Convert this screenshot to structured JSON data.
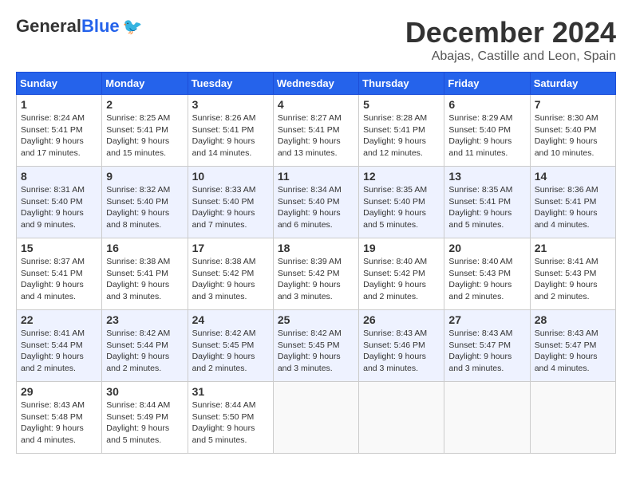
{
  "header": {
    "logo_general": "General",
    "logo_blue": "Blue",
    "month_title": "December 2024",
    "location": "Abajas, Castille and Leon, Spain"
  },
  "weekdays": [
    "Sunday",
    "Monday",
    "Tuesday",
    "Wednesday",
    "Thursday",
    "Friday",
    "Saturday"
  ],
  "weeks": [
    [
      {
        "day": "1",
        "sunrise": "8:24 AM",
        "sunset": "5:41 PM",
        "daylight": "9 hours and 17 minutes."
      },
      {
        "day": "2",
        "sunrise": "8:25 AM",
        "sunset": "5:41 PM",
        "daylight": "9 hours and 15 minutes."
      },
      {
        "day": "3",
        "sunrise": "8:26 AM",
        "sunset": "5:41 PM",
        "daylight": "9 hours and 14 minutes."
      },
      {
        "day": "4",
        "sunrise": "8:27 AM",
        "sunset": "5:41 PM",
        "daylight": "9 hours and 13 minutes."
      },
      {
        "day": "5",
        "sunrise": "8:28 AM",
        "sunset": "5:41 PM",
        "daylight": "9 hours and 12 minutes."
      },
      {
        "day": "6",
        "sunrise": "8:29 AM",
        "sunset": "5:40 PM",
        "daylight": "9 hours and 11 minutes."
      },
      {
        "day": "7",
        "sunrise": "8:30 AM",
        "sunset": "5:40 PM",
        "daylight": "9 hours and 10 minutes."
      }
    ],
    [
      {
        "day": "8",
        "sunrise": "8:31 AM",
        "sunset": "5:40 PM",
        "daylight": "9 hours and 9 minutes."
      },
      {
        "day": "9",
        "sunrise": "8:32 AM",
        "sunset": "5:40 PM",
        "daylight": "9 hours and 8 minutes."
      },
      {
        "day": "10",
        "sunrise": "8:33 AM",
        "sunset": "5:40 PM",
        "daylight": "9 hours and 7 minutes."
      },
      {
        "day": "11",
        "sunrise": "8:34 AM",
        "sunset": "5:40 PM",
        "daylight": "9 hours and 6 minutes."
      },
      {
        "day": "12",
        "sunrise": "8:35 AM",
        "sunset": "5:40 PM",
        "daylight": "9 hours and 5 minutes."
      },
      {
        "day": "13",
        "sunrise": "8:35 AM",
        "sunset": "5:41 PM",
        "daylight": "9 hours and 5 minutes."
      },
      {
        "day": "14",
        "sunrise": "8:36 AM",
        "sunset": "5:41 PM",
        "daylight": "9 hours and 4 minutes."
      }
    ],
    [
      {
        "day": "15",
        "sunrise": "8:37 AM",
        "sunset": "5:41 PM",
        "daylight": "9 hours and 4 minutes."
      },
      {
        "day": "16",
        "sunrise": "8:38 AM",
        "sunset": "5:41 PM",
        "daylight": "9 hours and 3 minutes."
      },
      {
        "day": "17",
        "sunrise": "8:38 AM",
        "sunset": "5:42 PM",
        "daylight": "9 hours and 3 minutes."
      },
      {
        "day": "18",
        "sunrise": "8:39 AM",
        "sunset": "5:42 PM",
        "daylight": "9 hours and 3 minutes."
      },
      {
        "day": "19",
        "sunrise": "8:40 AM",
        "sunset": "5:42 PM",
        "daylight": "9 hours and 2 minutes."
      },
      {
        "day": "20",
        "sunrise": "8:40 AM",
        "sunset": "5:43 PM",
        "daylight": "9 hours and 2 minutes."
      },
      {
        "day": "21",
        "sunrise": "8:41 AM",
        "sunset": "5:43 PM",
        "daylight": "9 hours and 2 minutes."
      }
    ],
    [
      {
        "day": "22",
        "sunrise": "8:41 AM",
        "sunset": "5:44 PM",
        "daylight": "9 hours and 2 minutes."
      },
      {
        "day": "23",
        "sunrise": "8:42 AM",
        "sunset": "5:44 PM",
        "daylight": "9 hours and 2 minutes."
      },
      {
        "day": "24",
        "sunrise": "8:42 AM",
        "sunset": "5:45 PM",
        "daylight": "9 hours and 2 minutes."
      },
      {
        "day": "25",
        "sunrise": "8:42 AM",
        "sunset": "5:45 PM",
        "daylight": "9 hours and 3 minutes."
      },
      {
        "day": "26",
        "sunrise": "8:43 AM",
        "sunset": "5:46 PM",
        "daylight": "9 hours and 3 minutes."
      },
      {
        "day": "27",
        "sunrise": "8:43 AM",
        "sunset": "5:47 PM",
        "daylight": "9 hours and 3 minutes."
      },
      {
        "day": "28",
        "sunrise": "8:43 AM",
        "sunset": "5:47 PM",
        "daylight": "9 hours and 4 minutes."
      }
    ],
    [
      {
        "day": "29",
        "sunrise": "8:43 AM",
        "sunset": "5:48 PM",
        "daylight": "9 hours and 4 minutes."
      },
      {
        "day": "30",
        "sunrise": "8:44 AM",
        "sunset": "5:49 PM",
        "daylight": "9 hours and 5 minutes."
      },
      {
        "day": "31",
        "sunrise": "8:44 AM",
        "sunset": "5:50 PM",
        "daylight": "9 hours and 5 minutes."
      },
      null,
      null,
      null,
      null
    ]
  ],
  "labels": {
    "sunrise": "Sunrise:",
    "sunset": "Sunset:",
    "daylight": "Daylight:"
  }
}
